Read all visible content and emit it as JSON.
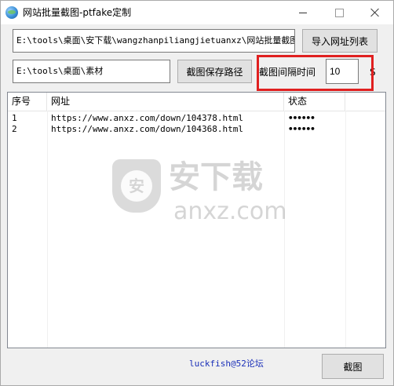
{
  "window": {
    "title": "网站批量截图-ptfake定制"
  },
  "url_list_path": {
    "value": "E:\\tools\\桌面\\安下载\\wangzhanpiliangjietuanxz\\网站批量截图\\"
  },
  "import_button_label": "导入网址列表",
  "save_path": {
    "value": "E:\\tools\\桌面\\素材"
  },
  "save_path_button_label": "截图保存路径",
  "interval": {
    "label": "截图间隔时间",
    "value": "10",
    "unit": "S"
  },
  "table": {
    "columns": [
      "序号",
      "网址",
      "状态"
    ],
    "rows": [
      {
        "index": "1",
        "url": "https://www.anxz.com/down/104378.html",
        "status": "••••••"
      },
      {
        "index": "2",
        "url": "https://www.anxz.com/down/104368.html",
        "status": "••••••"
      }
    ]
  },
  "watermark": {
    "shield_char": "安",
    "title": "安下载",
    "subtitle": "anxz.com"
  },
  "footer": {
    "credit": "luckfish@52论坛"
  },
  "capture_button_label": "截图",
  "colors": {
    "highlight": "#e02020",
    "credit_text": "#1a2fb8"
  }
}
